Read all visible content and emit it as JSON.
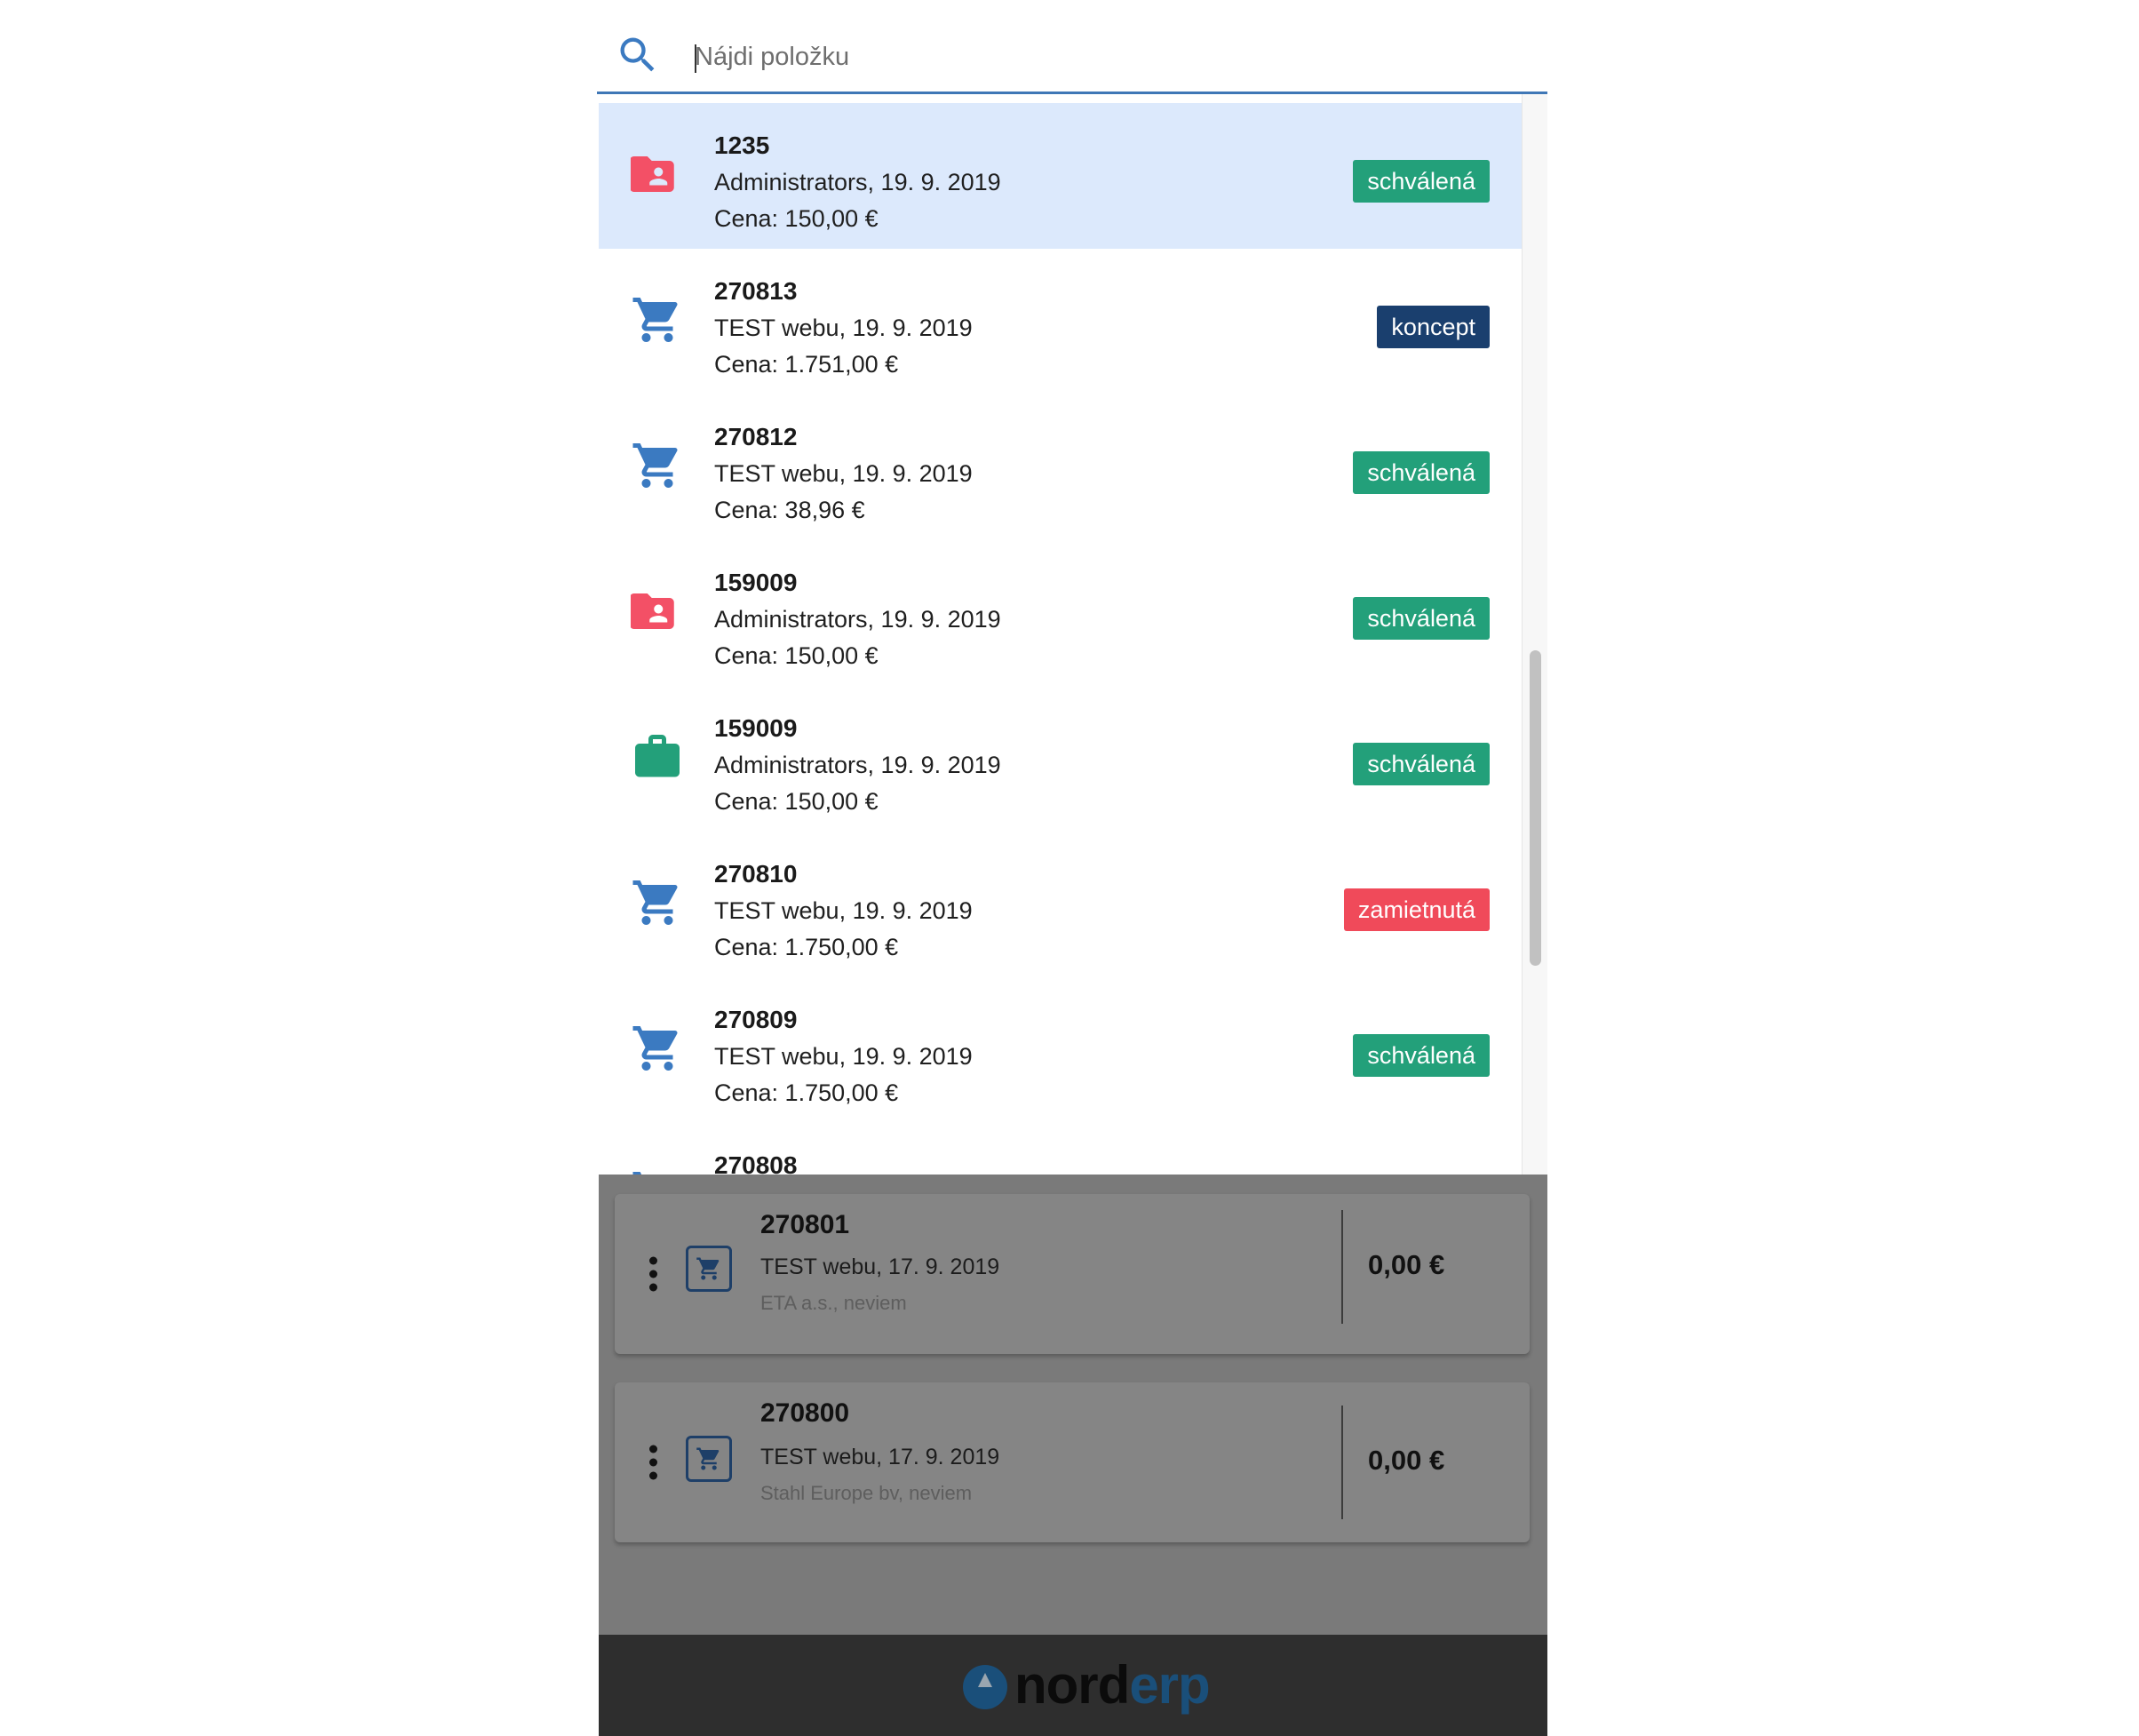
{
  "colors": {
    "accent": "#3f77b6",
    "selected_row": "#dce9fc",
    "approved": "#23a07a",
    "draft": "#1a3f6e",
    "rejected": "#f04a5a",
    "folder_icon": "#f35066",
    "cart_icon": "#3b7ac1",
    "briefcase_icon": "#23a07a"
  },
  "search": {
    "placeholder": "Nájdi položku",
    "value": ""
  },
  "results": [
    {
      "icon": "folder-person-icon",
      "number": "1235",
      "line1": "Administrators, 19. 9. 2019",
      "line2": "Cena: 150,00 €",
      "status": "schválená",
      "status_color": "#23a07a",
      "selected": true
    },
    {
      "icon": "cart-icon",
      "number": "270813",
      "line1": "TEST webu, 19. 9. 2019",
      "line2": "Cena: 1.751,00 €",
      "status": "koncept",
      "status_color": "#1a3f6e",
      "selected": false
    },
    {
      "icon": "cart-icon",
      "number": "270812",
      "line1": "TEST webu, 19. 9. 2019",
      "line2": "Cena: 38,96 €",
      "status": "schválená",
      "status_color": "#23a07a",
      "selected": false
    },
    {
      "icon": "folder-person-icon",
      "number": "159009",
      "line1": "Administrators, 19. 9. 2019",
      "line2": "Cena: 150,00 €",
      "status": "schválená",
      "status_color": "#23a07a",
      "selected": false
    },
    {
      "icon": "briefcase-icon",
      "number": "159009",
      "line1": "Administrators, 19. 9. 2019",
      "line2": "Cena: 150,00 €",
      "status": "schválená",
      "status_color": "#23a07a",
      "selected": false
    },
    {
      "icon": "cart-icon",
      "number": "270810",
      "line1": "TEST webu, 19. 9. 2019",
      "line2": "Cena: 1.750,00 €",
      "status": "zamietnutá",
      "status_color": "#f04a5a",
      "selected": false
    },
    {
      "icon": "cart-icon",
      "number": "270809",
      "line1": "TEST webu, 19. 9. 2019",
      "line2": "Cena: 1.750,00 €",
      "status": "schválená",
      "status_color": "#23a07a",
      "selected": false
    },
    {
      "icon": "cart-icon",
      "number": "270808",
      "line1": "",
      "line2": "",
      "status": "",
      "status_color": "#f04a5a",
      "selected": false
    }
  ],
  "background_cards": [
    {
      "icon": "cart-icon",
      "number": "270801",
      "line1": "TEST webu, 17. 9. 2019",
      "line2": "ETA a.s., neviem",
      "price": "0,00 €"
    },
    {
      "icon": "cart-icon",
      "number": "270800",
      "line1": "TEST webu, 17. 9. 2019",
      "line2": "Stahl Europe bv, neviem",
      "price": "0,00 €"
    }
  ],
  "footer": {
    "logo_part1": "nord",
    "logo_part2": "erp"
  }
}
